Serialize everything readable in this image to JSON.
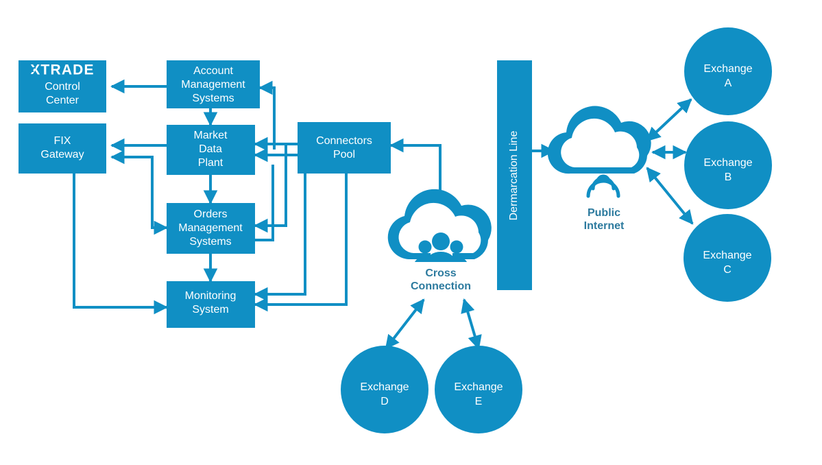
{
  "theme": {
    "brand_blue": "#108FC4",
    "line_blue": "#108FC4",
    "caption_blue": "#2C7A9E",
    "box_text": "#FFFFFF",
    "background": "#FFFFFF"
  },
  "boxes": [
    {
      "id": "control-center",
      "label_lines": [
        "Control",
        "Center"
      ],
      "logo": "XTRADE"
    },
    {
      "id": "account-management",
      "label_lines": [
        "Account",
        "Management",
        "Systems"
      ]
    },
    {
      "id": "fix-gateway",
      "label_lines": [
        "FIX",
        "Gateway"
      ]
    },
    {
      "id": "market-data-plant",
      "label_lines": [
        "Market",
        "Data",
        "Plant"
      ]
    },
    {
      "id": "connectors-pool",
      "label_lines": [
        "Connectors",
        "Pool"
      ]
    },
    {
      "id": "orders-management",
      "label_lines": [
        "Orders",
        "Management",
        "Systems"
      ]
    },
    {
      "id": "monitoring-system",
      "label_lines": [
        "Monitoring",
        "System"
      ]
    },
    {
      "id": "demarcation-line",
      "label_lines": [
        "Dermarcation Line"
      ]
    }
  ],
  "clouds": [
    {
      "id": "cross-connection",
      "caption_lines": [
        "Cross",
        "Connection"
      ],
      "icon": "people-icon"
    },
    {
      "id": "public-internet",
      "caption_lines": [
        "Public",
        "Internet"
      ],
      "icon": "wifi-icon"
    }
  ],
  "exchanges": [
    {
      "id": "exchange-a",
      "label_lines": [
        "Exchange",
        "A"
      ]
    },
    {
      "id": "exchange-b",
      "label_lines": [
        "Exchange",
        "B"
      ]
    },
    {
      "id": "exchange-c",
      "label_lines": [
        "Exchange",
        "C"
      ]
    },
    {
      "id": "exchange-d",
      "label_lines": [
        "Exchange",
        "D"
      ]
    },
    {
      "id": "exchange-e",
      "label_lines": [
        "Exchange",
        "E"
      ]
    }
  ],
  "logo": {
    "brand": "XTRADE"
  }
}
